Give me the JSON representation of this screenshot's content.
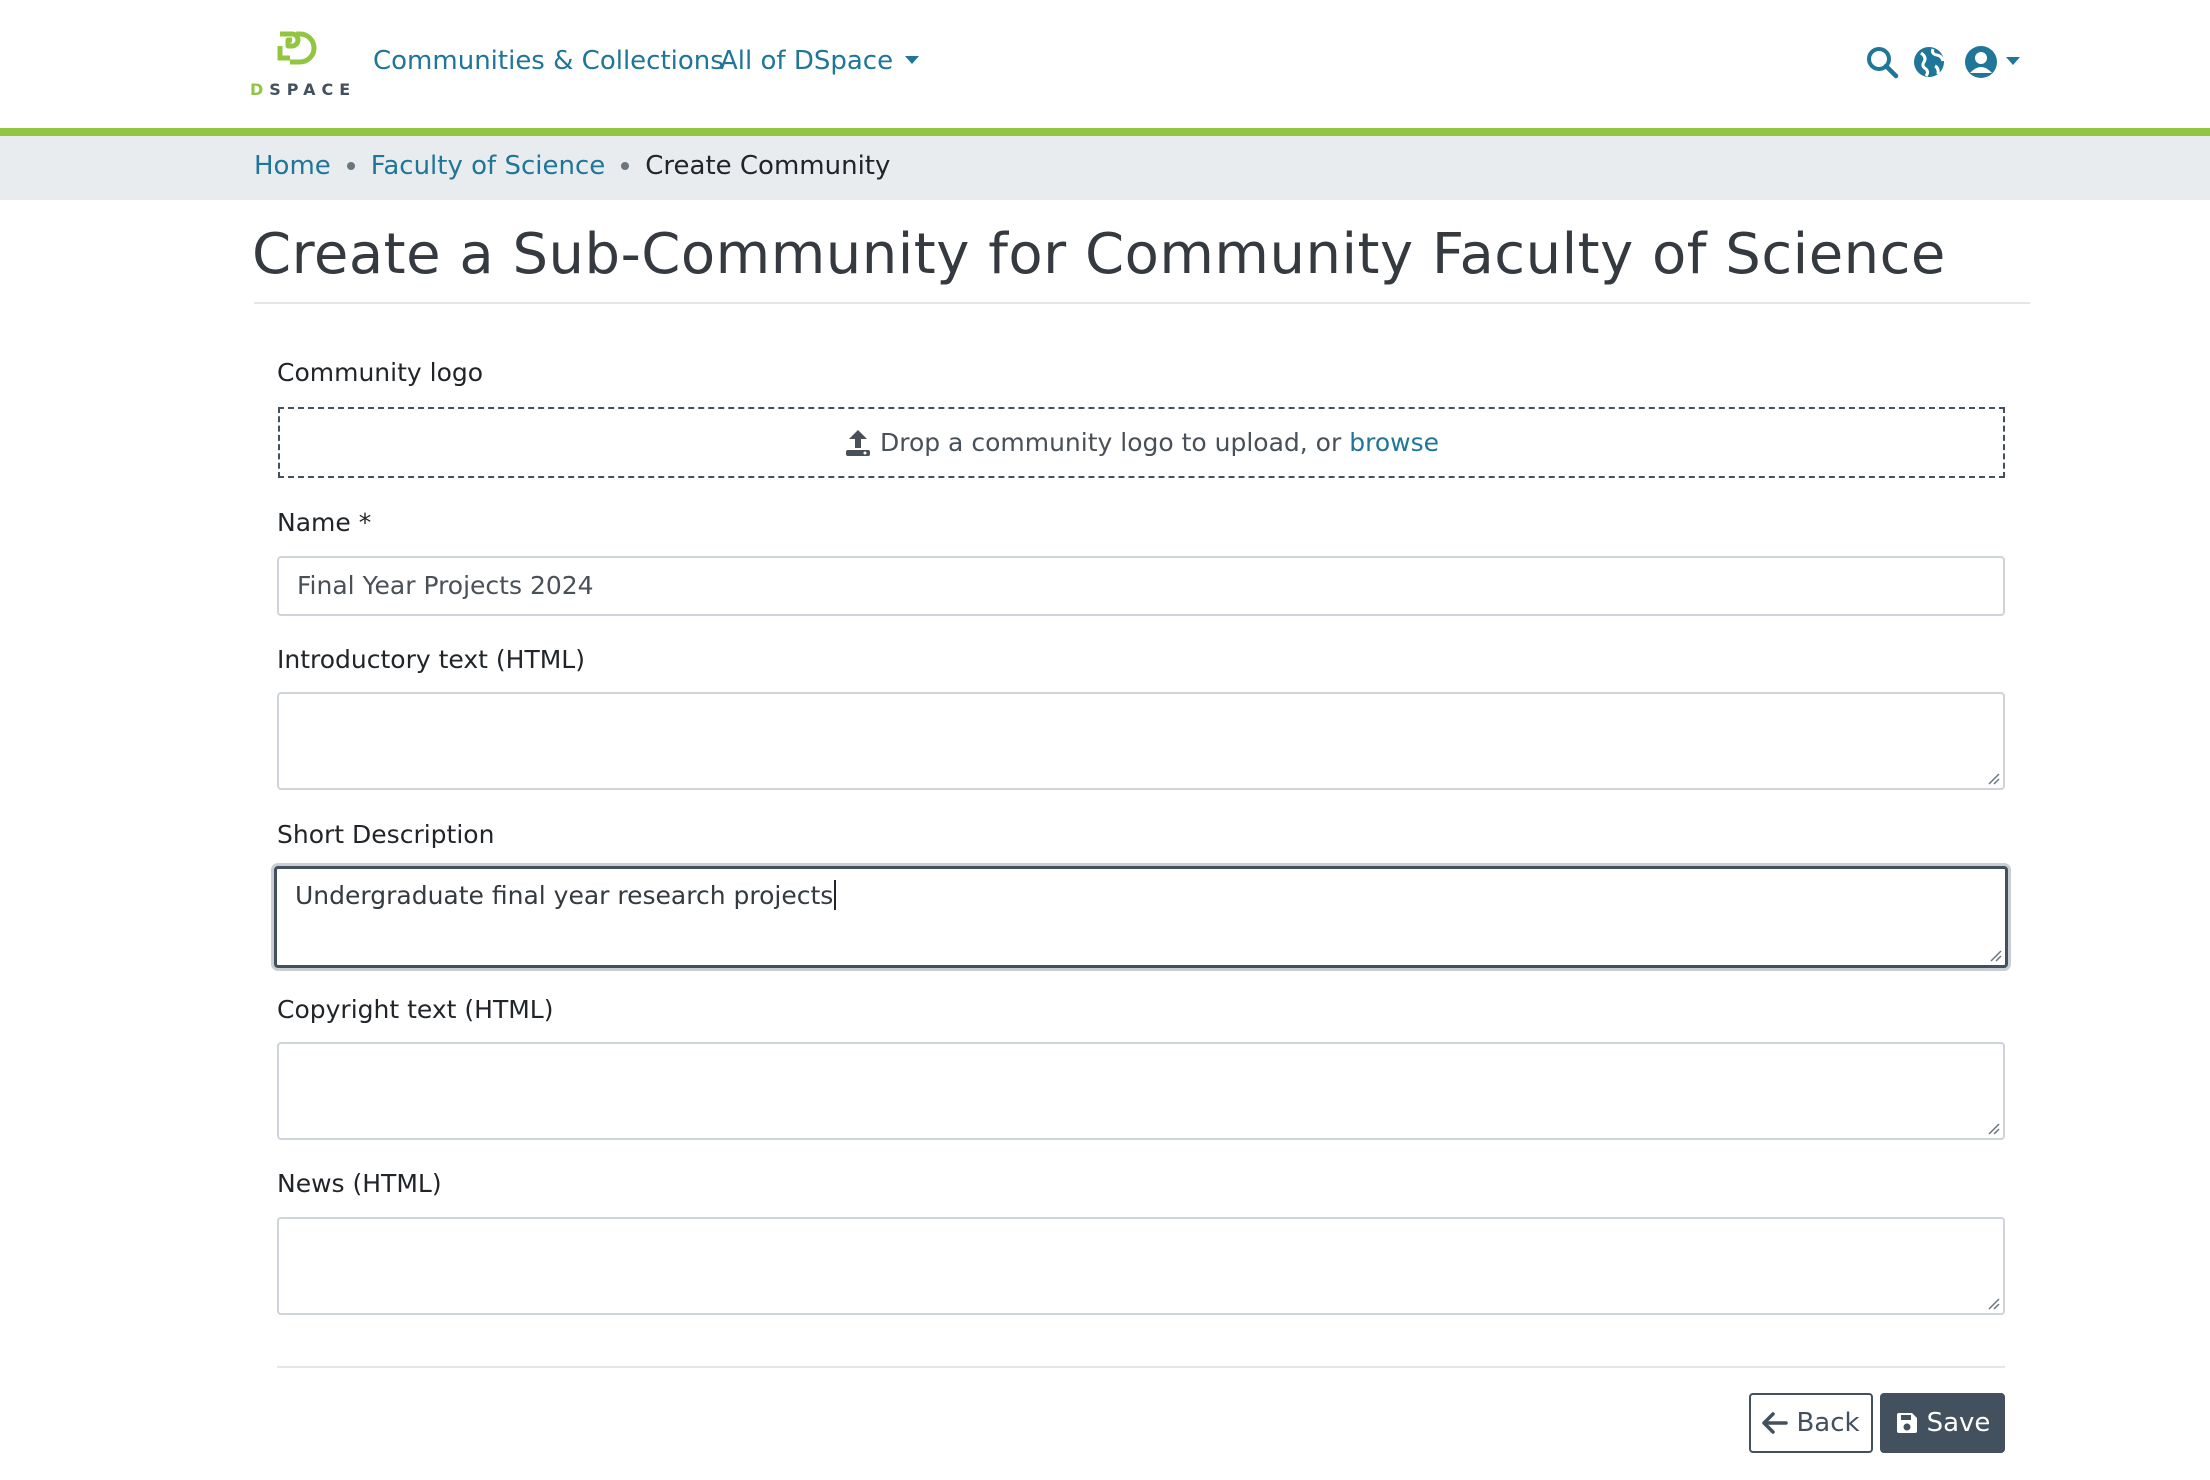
{
  "header": {
    "logo_text": "DSPACE",
    "nav": {
      "communities_label": "Communities & Collections",
      "all_label": "All of DSpace"
    },
    "icons": [
      "search-icon",
      "globe-icon",
      "user-icon"
    ]
  },
  "breadcrumb": {
    "home": "Home",
    "parent": "Faculty of Science",
    "current": "Create Community"
  },
  "page": {
    "title": "Create a Sub-Community for Community Faculty of Science"
  },
  "form": {
    "logo_label": "Community logo",
    "dropzone_text": "Drop a community logo to upload, or",
    "browse_label": "browse",
    "name_label": "Name *",
    "name_value": "Final Year Projects 2024",
    "intro_label": "Introductory text (HTML)",
    "intro_value": "",
    "short_desc_label": "Short Description",
    "short_desc_value": "Undergraduate final year research projects",
    "copyright_label": "Copyright text (HTML)",
    "copyright_value": "",
    "news_label": "News (HTML)",
    "news_value": ""
  },
  "buttons": {
    "back_label": "Back",
    "save_label": "Save"
  },
  "colors": {
    "accent_green": "#92c642",
    "link_blue": "#207698",
    "primary_dark": "#43515f",
    "breadcrumb_bg": "#e9ecef"
  }
}
